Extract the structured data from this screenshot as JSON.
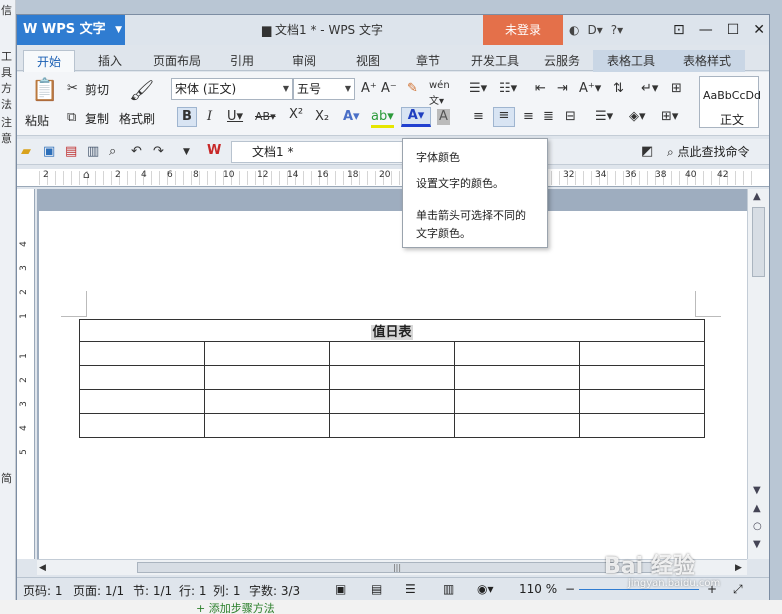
{
  "app": {
    "name": "WPS 文字",
    "window_title": "文档1 * - WPS 文字",
    "login_button": "未登录"
  },
  "background": {
    "left_fragments": [
      "简",
      "工具",
      "方法",
      "注意",
      "信"
    ],
    "bottom_link": "+ 添加步骤方法"
  },
  "tabs": [
    {
      "label": "开始"
    },
    {
      "label": "插入"
    },
    {
      "label": "页面布局"
    },
    {
      "label": "引用"
    },
    {
      "label": "审阅"
    },
    {
      "label": "视图"
    },
    {
      "label": "章节"
    },
    {
      "label": "开发工具"
    },
    {
      "label": "云服务"
    },
    {
      "label": "表格工具"
    },
    {
      "label": "表格样式"
    }
  ],
  "ribbon": {
    "paste": "粘贴",
    "cut": "剪切",
    "copy": "复制",
    "format_painter": "格式刷",
    "font_name": "宋体 (正文)",
    "font_size": "五号",
    "style_preview": "AaBbCcDd",
    "style_name": "正文"
  },
  "quick_access": {
    "doc_tab": "文档1 *",
    "search": "点此查找命令"
  },
  "ruler": {
    "h_labels": [
      "2",
      "2",
      "4",
      "6",
      "8",
      "10",
      "12",
      "14",
      "16",
      "18",
      "20",
      "32",
      "34",
      "36",
      "38",
      "40",
      "42"
    ],
    "v_labels": [
      "4",
      "3",
      "2",
      "1",
      "1",
      "2",
      "3",
      "4",
      "5"
    ]
  },
  "document": {
    "table_title": "值日表",
    "rows": 4,
    "cols": 5
  },
  "tooltip": {
    "title": "字体颜色",
    "line1": "设置文字的颜色。",
    "line2": "单击箭头可选择不同的",
    "line3": "文字颜色。"
  },
  "status": {
    "page": "页码: 1",
    "pages": "页面: 1/1",
    "section": "节: 1/1",
    "row": "行: 1",
    "col": "列: 1",
    "chars": "字数: 3/3",
    "zoom": "110 %"
  },
  "watermark": {
    "text": "Bai 经验",
    "url": "jingyan.baidu.com"
  }
}
